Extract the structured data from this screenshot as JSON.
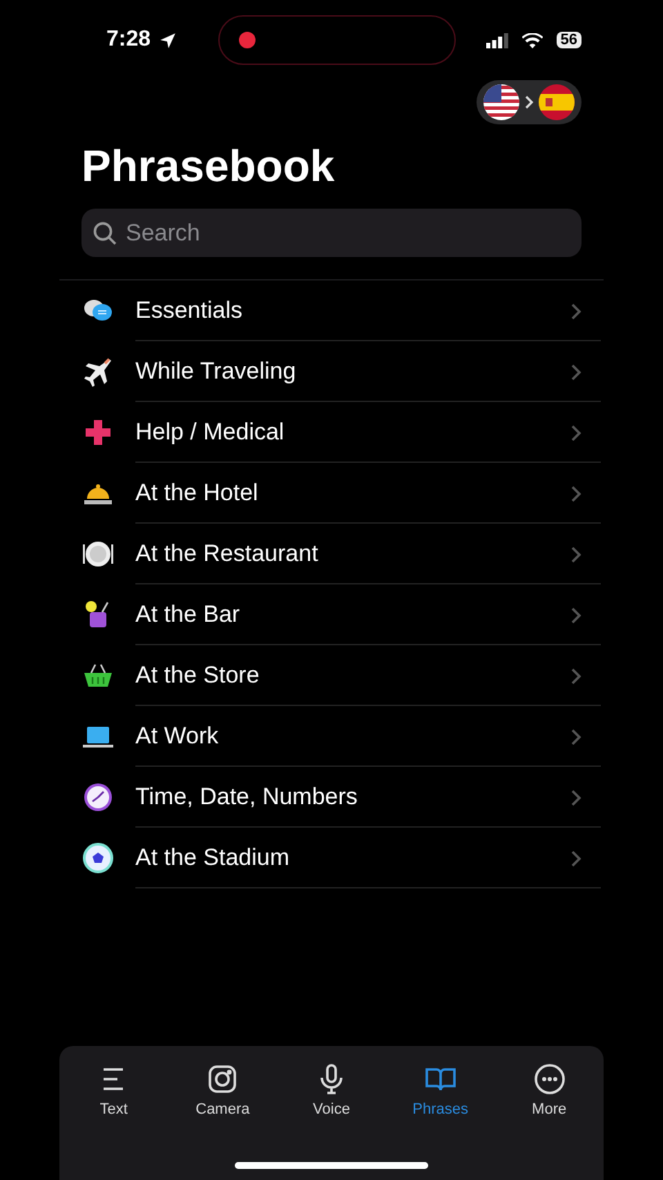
{
  "status_bar": {
    "time": "7:28",
    "battery": "56",
    "recording": true
  },
  "title": "Phrasebook",
  "search": {
    "placeholder": "Search"
  },
  "categories": [
    {
      "label": "Essentials",
      "kind": "chat"
    },
    {
      "label": "While Traveling",
      "kind": "plane"
    },
    {
      "label": "Help / Medical",
      "kind": "cross"
    },
    {
      "label": "At the Hotel",
      "kind": "bell"
    },
    {
      "label": "At the Restaurant",
      "kind": "plate"
    },
    {
      "label": "At the Bar",
      "kind": "drink"
    },
    {
      "label": "At the Store",
      "kind": "basket"
    },
    {
      "label": "At Work",
      "kind": "laptop"
    },
    {
      "label": "Time, Date, Numbers",
      "kind": "clock"
    },
    {
      "label": "At the Stadium",
      "kind": "ball"
    }
  ],
  "tabs": [
    {
      "label": "Text",
      "kind": "text",
      "selected": false
    },
    {
      "label": "Camera",
      "kind": "camera",
      "selected": false
    },
    {
      "label": "Voice",
      "kind": "mic",
      "selected": false
    },
    {
      "label": "Phrases",
      "kind": "book",
      "selected": true
    },
    {
      "label": "More",
      "kind": "more",
      "selected": false
    }
  ]
}
